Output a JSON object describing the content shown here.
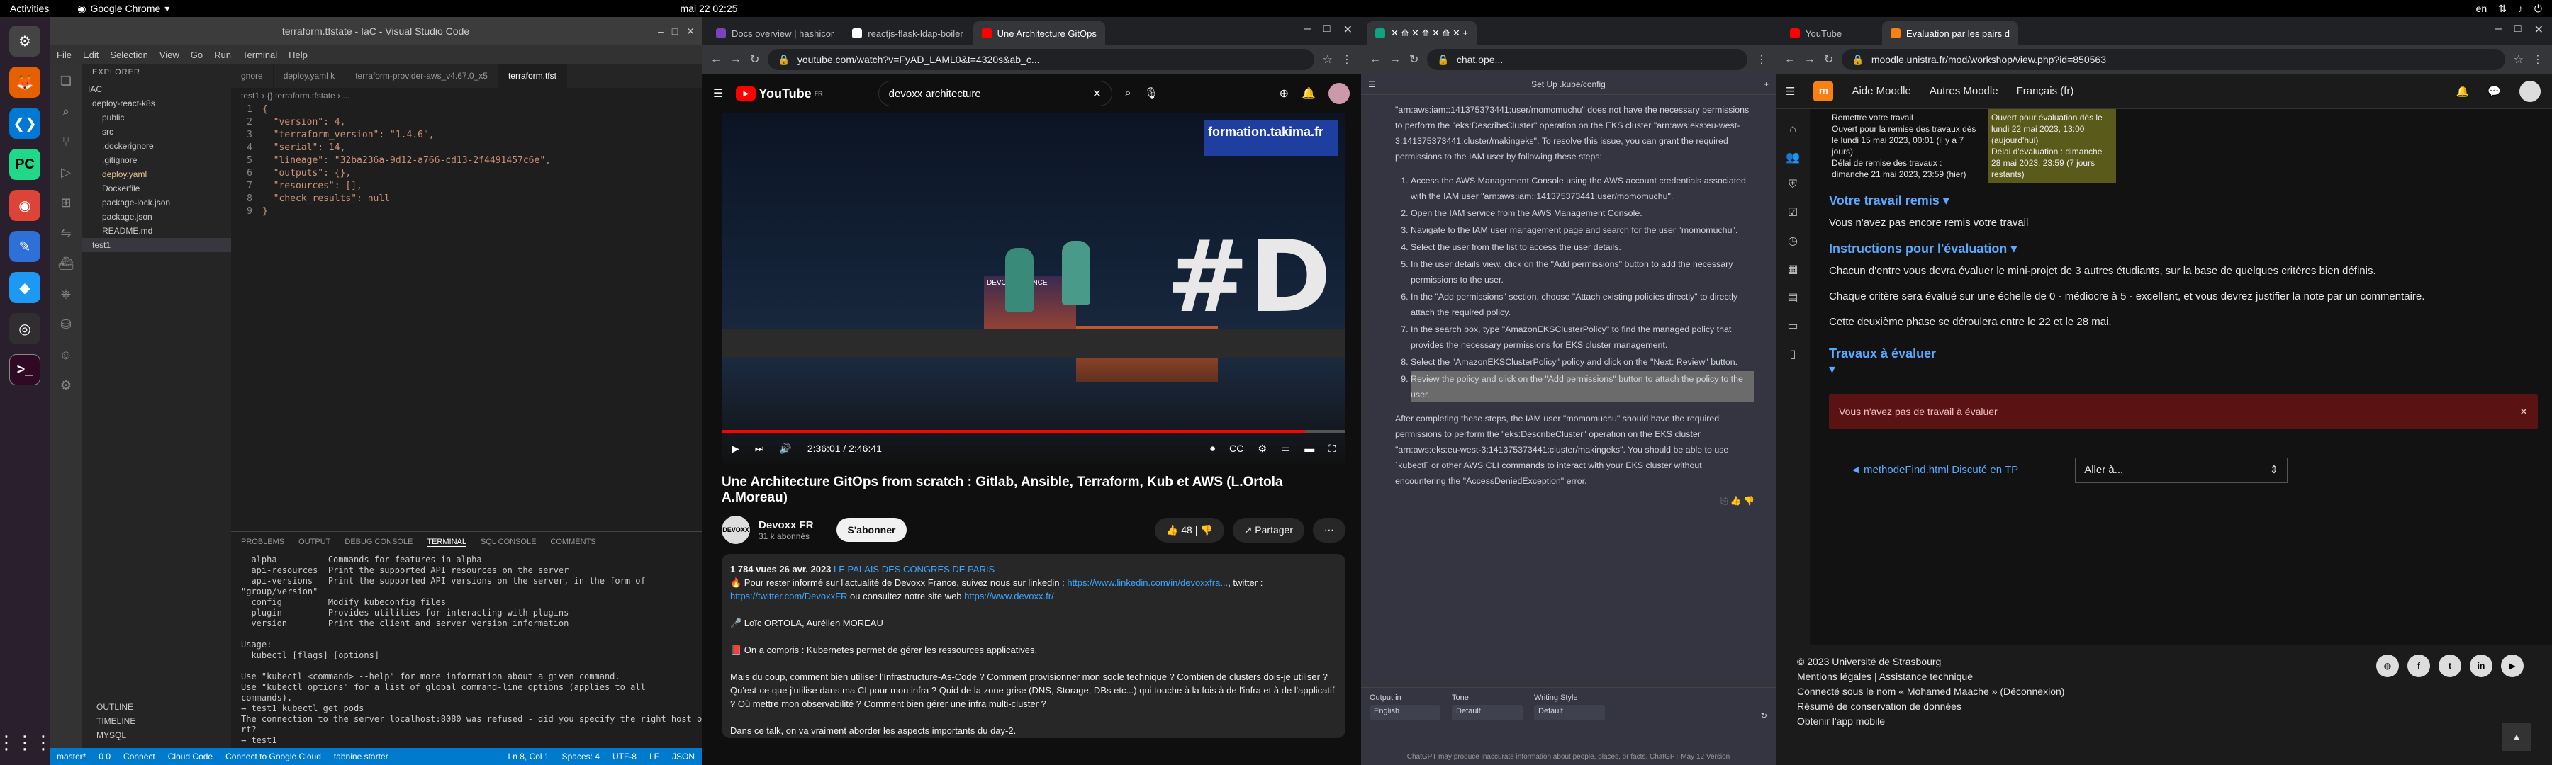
{
  "topbar": {
    "activities": "Activities",
    "app": "Google Chrome",
    "clock": "mai 22  02:25",
    "lang": "en"
  },
  "dock": {
    "icons": [
      "apps-icon",
      "firefox-icon",
      "vscode-icon",
      "pycharm-icon",
      "chrome-icon",
      "notes-icon",
      "dolphin-icon",
      "obs-icon",
      "terminal-icon"
    ]
  },
  "vscode": {
    "title": "terraform.tfstate - IaC - Visual Studio Code",
    "menu": [
      "File",
      "Edit",
      "Selection",
      "View",
      "Go",
      "Run",
      "Terminal",
      "Help"
    ],
    "explorer": "EXPLORER",
    "tree": [
      "IAC",
      "deploy-react-k8s",
      "public",
      "src",
      ".dockerignore",
      ".gitignore",
      "deploy.yaml",
      "Dockerfile",
      "package-lock.json",
      "package.json",
      "README.md",
      "test1"
    ],
    "outline": [
      "OUTLINE",
      "TIMELINE",
      "MYSQL"
    ],
    "tabs": [
      "gnore",
      "deploy.yaml  k",
      "terraform-provider-aws_v4.67.0_x5",
      "terraform.tfst"
    ],
    "breadcrumb": "test1 › {} terraform.tfstate › ...",
    "code": [
      [
        "1",
        "{"
      ],
      [
        "2",
        "  \"version\": 4,"
      ],
      [
        "3",
        "  \"terraform_version\": \"1.4.6\","
      ],
      [
        "4",
        "  \"serial\": 14,"
      ],
      [
        "5",
        "  \"lineage\": \"32ba236a-9d12-a766-cd13-2f4491457c6e\","
      ],
      [
        "6",
        "  \"outputs\": {},"
      ],
      [
        "7",
        "  \"resources\": [],"
      ],
      [
        "8",
        "  \"check_results\": null"
      ],
      [
        "9",
        "}"
      ]
    ],
    "panel_tabs": [
      "PROBLEMS",
      "OUTPUT",
      "DEBUG CONSOLE",
      "TERMINAL",
      "SQL CONSOLE",
      "COMMENTS"
    ],
    "terminal": "  alpha          Commands for features in alpha\n  api-resources  Print the supported API resources on the server\n  api-versions   Print the supported API versions on the server, in the form of\n\"group/version\"\n  config         Modify kubeconfig files\n  plugin         Provides utilities for interacting with plugins\n  version        Print the client and server version information\n\nUsage:\n  kubectl [flags] [options]\n\nUse \"kubectl <command> --help\" for more information about a given command.\nUse \"kubectl options\" for a list of global command-line options (applies to all\ncommands).\n→ test1 kubectl get pods\nThe connection to the server localhost:8080 was refused - did you specify the right host or po\nrt?\n→ test1 ",
    "status_left": [
      "master*",
      "0  0",
      "Connect",
      "Cloud Code",
      "Connect to Google Cloud",
      "tabnine starter"
    ],
    "status_right": [
      "Ln 8, Col 1",
      "Spaces: 4",
      "UTF-8",
      "LF",
      "JSON"
    ]
  },
  "yt_chrome": {
    "tabs": [
      "Docs overview | hashicor",
      "reactjs-flask-ldap-boiler",
      "Une Architecture GitOps"
    ],
    "url": "youtube.com/watch?v=FyAD_LAML0&t=4320s&ab_c..."
  },
  "youtube": {
    "brand": "YouTube",
    "region": "FR",
    "search": "devoxx architecture",
    "time": "2:36:01 / 2:46:41",
    "progress": 0.935,
    "title": "Une Architecture GitOps from scratch : Gitlab, Ansible, Terraform, Kub et AWS (L.Ortola A.Moreau)",
    "channel": "Devoxx FR",
    "subs": "31 k abonnés",
    "subscribe": "S'abonner",
    "likes": "48",
    "share": "Partager",
    "stats": "1 784 vues  26 avr. 2023",
    "place": "LE PALAIS DES CONGRÈS DE PARIS",
    "desc1": "🔥 Pour rester informé sur l'actualité de Devoxx France, suivez nous sur linkedin : ",
    "desc1link": "https://www.linkedin.com/in/devoxxfra...",
    "desc1b": ", twitter :",
    "desc2link": "https://twitter.com/DevoxxFR",
    "desc2": " ou consultez notre site web ",
    "desc2link2": "https://www.devoxx.fr/",
    "speakers": "🎤 Loïc ORTOLA, Aurélien MOREAU",
    "p1": "📕 On a compris : Kubernetes permet de gérer les ressources applicatives.",
    "p2": "Mais du coup, comment bien utiliser l'Infrastructure-As-Code ? Comment provisionner mon socle technique ? Combien de clusters dois-je utiliser ? Qu'est-ce que j'utilise dans ma CI pour mon infra ? Quid de la zone grise (DNS, Storage, DBs etc...) qui touche à la fois à de l'infra et à de l'applicatif ? Où mettre mon observabilité ? Comment bien gérer une infra multi-cluster ?",
    "p3": "Dans ce talk, on va vraiment aborder les aspects importants du day-2.",
    "banner": "formation.takima.fr",
    "screen": "DEVOXX FRANCE",
    "hash": "#D"
  },
  "gpt_chrome": {
    "url": "chat.ope..."
  },
  "gpt": {
    "header": "Set Up .kube/config",
    "intro": "\"arn:aws:iam::141375373441:user/momomuchu\" does not have the necessary permissions to perform the \"eks:DescribeCluster\" operation on the EKS cluster \"arn:aws:eks:eu-west-3:141375373441:cluster/makingeks\". To resolve this issue, you can grant the required permissions to the IAM user by following these steps:",
    "steps": [
      "Access the AWS Management Console using the AWS account credentials associated with the IAM user \"arn:aws:iam::141375373441:user/momomuchu\".",
      "Open the IAM service from the AWS Management Console.",
      "Navigate to the IAM user management page and search for the user \"momomuchu\".",
      "Select the user from the list to access the user details.",
      "In the user details view, click on the \"Add permissions\" button to add the necessary permissions to the user.",
      "In the \"Add permissions\" section, choose \"Attach existing policies directly\" to directly attach the required policy.",
      "In the search box, type \"AmazonEKSClusterPolicy\" to find the managed policy that provides the necessary permissions for EKS cluster management.",
      "Select the \"AmazonEKSClusterPolicy\" policy and click on the \"Next: Review\" button.",
      "Review the policy and click on the \"Add permissions\" button to attach the policy to the user."
    ],
    "outro": "After completing these steps, the IAM user \"momomuchu\" should have the required permissions to perform the \"eks:DescribeCluster\" operation on the EKS cluster \"arn:aws:eks:eu-west-3:141375373441:cluster/makingeks\". You should be able to use `kubectl` or other AWS CLI commands to interact with your EKS cluster without encountering the \"AccessDeniedException\" error.",
    "out_label": "Output in",
    "out_val": "English",
    "tone_label": "Tone",
    "tone_val": "Default",
    "style_label": "Writing Style",
    "style_val": "Default",
    "disclaimer": "ChatGPT may produce inaccurate information about people, places, or facts. ChatGPT May 12 Version"
  },
  "moodle_chrome": {
    "tabs": [
      "YouTube",
      "Evaluation par les pairs d"
    ],
    "url": "moodle.unistra.fr/mod/workshop/view.php?id=850563"
  },
  "moodle": {
    "nav": [
      "Aide Moodle",
      "Autres Moodle",
      "Français (fr)"
    ],
    "card1": [
      "Remettre votre travail",
      "Ouvert pour la remise des travaux dès le lundi 15 mai 2023, 00:01 (il y a 7 jours)",
      "Délai de remise des travaux : dimanche 21 mai 2023, 23:59 (hier)"
    ],
    "card2": [
      "Ouvert pour évaluation dès le lundi 22 mai 2023, 13:00 (aujourd'hui)",
      "Délai d'évaluation : dimanche 28 mai 2023, 23:59 (7 jours restants)"
    ],
    "h1": "Votre travail remis",
    "t1": "Vous n'avez pas encore remis votre travail",
    "h2": "Instructions pour l'évaluation",
    "t2a": "Chacun d'entre vous devra évaluer le mini-projet de 3 autres étudiants, sur la base de quelques critères bien définis.",
    "t2b": "Chaque critère sera évalué sur une échelle de 0 - médiocre à 5 - excellent, et vous devrez justifier la note par un commentaire.",
    "t2c": "Cette deuxième phase se déroulera entre le 22 et le 28 mai.",
    "h3": "Travaux à évaluer",
    "alert": "Vous n'avez pas de travail à évaluer",
    "prev": "◄ methodeFind.html Discuté en TP",
    "goto": "Aller à...",
    "footer": [
      "© 2023 Université de Strasbourg",
      "Mentions légales  |  Assistance technique",
      "Connecté sous le nom « Mohamed Maache » (Déconnexion)",
      "Résumé de conservation de données",
      "Obtenir l'app mobile"
    ]
  },
  "colors": {
    "vs_status": "#007acc",
    "yt_red": "#ff0000",
    "moodle_orange": "#f98012",
    "moodle_link": "#5aa9ff"
  }
}
